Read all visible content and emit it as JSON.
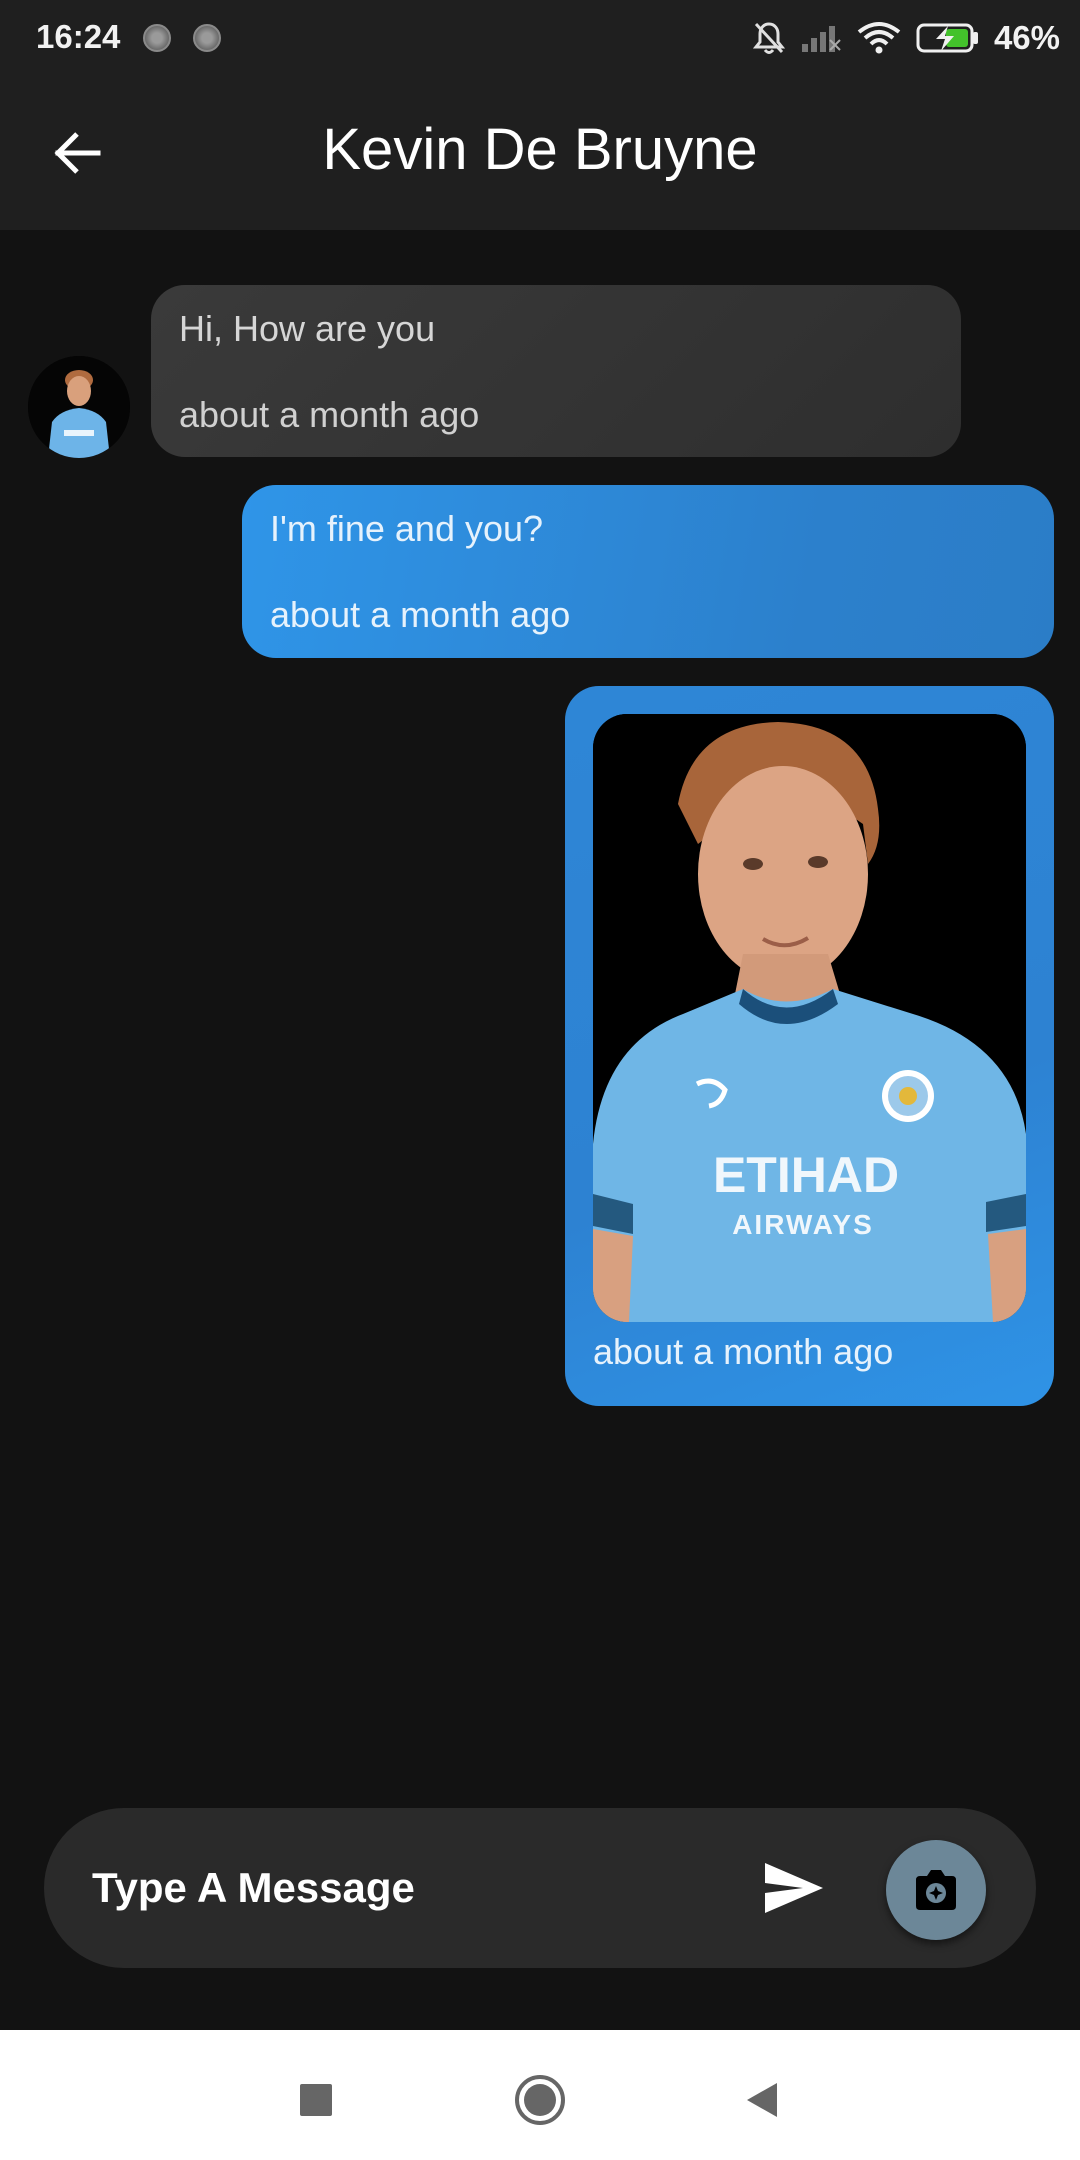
{
  "status_bar": {
    "time": "16:24",
    "battery_percent": "46%",
    "icons": [
      "notifications-off-icon",
      "signal-icon",
      "wifi-icon",
      "battery-charging-icon"
    ]
  },
  "header": {
    "title": "Kevin De Bruyne",
    "back_icon": "arrow-left-icon"
  },
  "messages": [
    {
      "direction": "received",
      "text": "Hi, How are you",
      "time": "about a month ago"
    },
    {
      "direction": "sent",
      "text": "I'm fine and you?",
      "time": "about a month ago"
    },
    {
      "direction": "sent",
      "type": "image",
      "image_alt": "photo",
      "time": "about a month ago"
    }
  ],
  "composer": {
    "placeholder": "Type A Message",
    "send_icon": "send-icon",
    "camera_icon": "camera-icon"
  },
  "nav_bar": {
    "icons": [
      "recents-square-icon",
      "home-circle-icon",
      "back-triangle-icon"
    ]
  },
  "colors": {
    "background": "#121212",
    "app_bar": "#1f1f1f",
    "received_bubble": "#333333",
    "sent_bubble": "#2f8fe0",
    "camera_button": "#6c8798"
  }
}
